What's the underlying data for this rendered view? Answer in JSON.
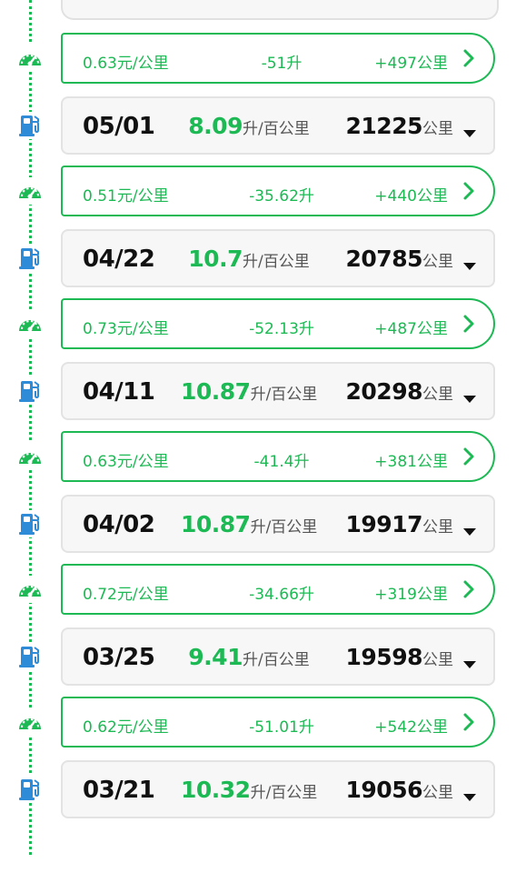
{
  "colors": {
    "accent": "#1db954",
    "pump": "#2e8bd8",
    "text": "#111111",
    "muted": "#555555"
  },
  "icons": {
    "segment": "speedometer-icon",
    "fill": "fuel-pump-icon",
    "arrow": "chevron-right-icon",
    "expand": "caret-down-icon"
  },
  "entries": [
    {
      "type": "segment",
      "cost": "0.63元/公里",
      "fuel": "-51升",
      "distance": "+497公里"
    },
    {
      "type": "fill",
      "date": "05/01",
      "efficiency": "8.09",
      "efficiency_unit": "升/百公里",
      "odometer": "21225",
      "odometer_unit": "公里"
    },
    {
      "type": "segment",
      "cost": "0.51元/公里",
      "fuel": "-35.62升",
      "distance": "+440公里"
    },
    {
      "type": "fill",
      "date": "04/22",
      "efficiency": "10.7",
      "efficiency_unit": "升/百公里",
      "odometer": "20785",
      "odometer_unit": "公里"
    },
    {
      "type": "segment",
      "cost": "0.73元/公里",
      "fuel": "-52.13升",
      "distance": "+487公里"
    },
    {
      "type": "fill",
      "date": "04/11",
      "efficiency": "10.87",
      "efficiency_unit": "升/百公里",
      "odometer": "20298",
      "odometer_unit": "公里"
    },
    {
      "type": "segment",
      "cost": "0.63元/公里",
      "fuel": "-41.4升",
      "distance": "+381公里"
    },
    {
      "type": "fill",
      "date": "04/02",
      "efficiency": "10.87",
      "efficiency_unit": "升/百公里",
      "odometer": "19917",
      "odometer_unit": "公里"
    },
    {
      "type": "segment",
      "cost": "0.72元/公里",
      "fuel": "-34.66升",
      "distance": "+319公里"
    },
    {
      "type": "fill",
      "date": "03/25",
      "efficiency": "9.41",
      "efficiency_unit": "升/百公里",
      "odometer": "19598",
      "odometer_unit": "公里"
    },
    {
      "type": "segment",
      "cost": "0.62元/公里",
      "fuel": "-51.01升",
      "distance": "+542公里"
    },
    {
      "type": "fill",
      "date": "03/21",
      "efficiency": "10.32",
      "efficiency_unit": "升/百公里",
      "odometer": "19056",
      "odometer_unit": "公里"
    }
  ]
}
